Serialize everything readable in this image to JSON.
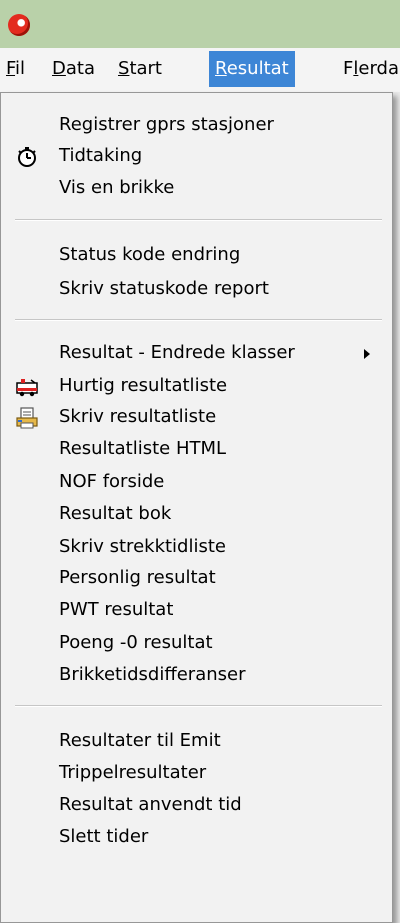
{
  "menu_bar": {
    "items": [
      {
        "accel": "F",
        "rest": "il"
      },
      {
        "accel": "D",
        "rest": "ata"
      },
      {
        "accel": "S",
        "rest": "tart"
      },
      {
        "accel": "R",
        "rest": "esultat"
      },
      {
        "lead": "F",
        "accel": "l",
        "rest": "erda"
      }
    ]
  },
  "dropdown": {
    "items": [
      "Registrer gprs stasjoner",
      "Tidtaking",
      "Vis en brikke",
      "Status kode endring",
      "Skriv statuskode report",
      "Resultat - Endrede klasser",
      "Hurtig resultatliste",
      "Skriv resultatliste",
      "Resultatliste HTML",
      "NOF forside",
      "Resultat bok",
      "Skriv strekktidliste",
      "Personlig resultat",
      "PWT resultat",
      "Poeng -0 resultat",
      "Brikketidsdifferanser",
      "Resultater til Emit",
      "Trippelresultater",
      "Resultat anvendt tid",
      "Slett tider"
    ]
  },
  "colors": {
    "titlebar": "#b9d1a9",
    "menu_highlight": "#3d86d6",
    "menu_background": "#f2f2f2"
  },
  "icons": {
    "app": "app-logo-icon",
    "tidtaking": "stopwatch-icon",
    "hurtig": "ambulance-icon",
    "skriv": "printer-document-icon",
    "submenu": "submenu-arrow-icon"
  }
}
